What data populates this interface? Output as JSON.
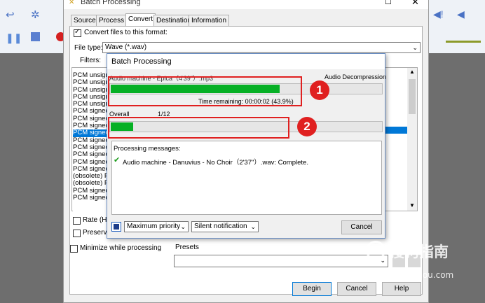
{
  "dialog": {
    "title": "Batch Processing",
    "tabs": [
      {
        "label": "Source"
      },
      {
        "label": "Process"
      },
      {
        "label": "Convert"
      },
      {
        "label": "Destination"
      },
      {
        "label": "Information"
      }
    ],
    "convert_checkbox_label": "Convert files to this format:",
    "file_type_label": "File type:",
    "file_type_value": "Wave (*.wav)",
    "filters_label": "Filters:",
    "format_list": [
      "PCM unsigne",
      "PCM unsigne",
      "PCM unsigne",
      "PCM unsigne",
      "PCM unsigne",
      "PCM signed",
      "PCM signed",
      "PCM signed",
      "PCM signed",
      "PCM signed",
      "PCM signed",
      "PCM signed",
      "PCM signed",
      "PCM signed",
      "(obsolete) P",
      "(obsolete) P",
      "PCM signed",
      "PCM signed"
    ],
    "format_list_selected_index": 8,
    "rate_label": "Rate (Hz)",
    "preserve_label": "Preserve",
    "minimize_label": "Minimize while processing",
    "presets_label": "Presets",
    "begin_label": "Begin",
    "cancel_label": "Cancel",
    "help_label": "Help"
  },
  "batch": {
    "title": "Batch Processing",
    "current_file": "Audio machine - Epica（4'39\"）.mp3",
    "current_stage": "Audio Decompression",
    "current_progress": 0.439,
    "time_remaining": "Time remaining: 00:00:02 (43.9%)",
    "overall_label": "Overall",
    "overall_count": "1/12",
    "overall_progress": 0.083,
    "messages_label": "Processing messages:",
    "messages": [
      "Audio machine - Danuvius - No Choir（2'37\"）.wav: Complete."
    ],
    "priority_value": "Maximum priority",
    "notification_value": "Silent notification",
    "cancel_label": "Cancel"
  },
  "annotations": {
    "badge1": "1",
    "badge2": "2",
    "color": "#e02020"
  },
  "watermark": {
    "brand": "搜狗指南",
    "url": "zhinan.sogou.com"
  },
  "icons": [
    "app-logo-icon",
    "minimize-icon",
    "maximize-icon",
    "close-icon",
    "check-icon",
    "dropdown-arrow-icon",
    "scroll-up-icon",
    "scroll-down-icon",
    "stop-icon",
    "undo-icon",
    "record-icon",
    "pause-icon",
    "speaker-icon"
  ]
}
